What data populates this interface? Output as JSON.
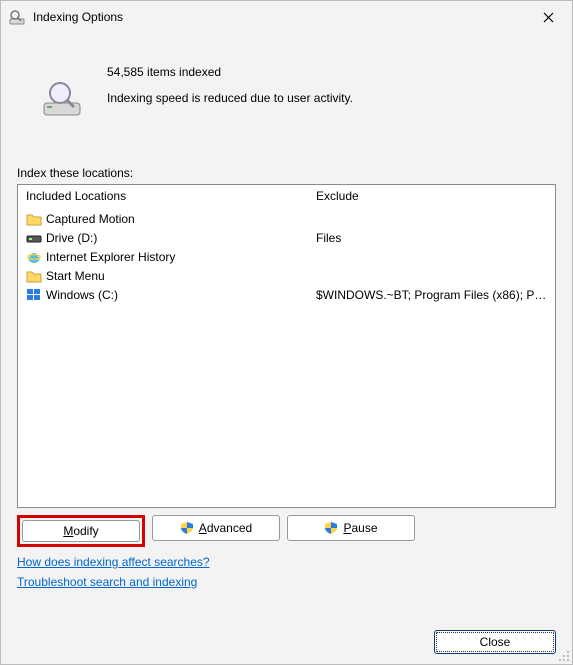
{
  "title": "Indexing Options",
  "status": {
    "items_indexed": "54,585 items indexed",
    "speed_note": "Indexing speed is reduced due to user activity."
  },
  "section_label": "Index these locations:",
  "columns": {
    "included": "Included Locations",
    "exclude": "Exclude"
  },
  "locations": [
    {
      "icon": "folder",
      "label": "Captured Motion",
      "exclude": ""
    },
    {
      "icon": "drive",
      "label": "Drive (D:)",
      "exclude": "Files"
    },
    {
      "icon": "ie",
      "label": "Internet Explorer History",
      "exclude": ""
    },
    {
      "icon": "folder",
      "label": "Start Menu",
      "exclude": ""
    },
    {
      "icon": "windows",
      "label": "Windows (C:)",
      "exclude": "$WINDOWS.~BT; Program Files (x86); Pr..."
    }
  ],
  "buttons": {
    "modify": "Modify",
    "advanced": "Advanced",
    "pause": "Pause",
    "close": "Close"
  },
  "links": {
    "how": "How does indexing affect searches?",
    "troubleshoot": "Troubleshoot search and indexing"
  }
}
